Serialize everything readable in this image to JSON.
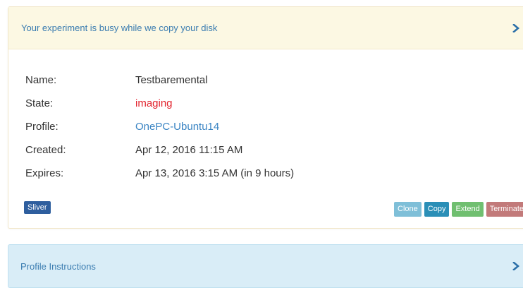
{
  "status_panel": {
    "heading": "Your experiment is busy while we copy your disk",
    "chevron_icon": "chevron-right-icon",
    "rows": [
      {
        "label": "Name:",
        "value": "Testbaremental"
      },
      {
        "label": "State:",
        "value": "imaging",
        "color": "#e2232d"
      },
      {
        "label": "Profile:",
        "value": "OnePC-Ubuntu14",
        "color": "#3a84c3"
      },
      {
        "label": "Created:",
        "value": "Apr 12, 2016 11:15 AM"
      },
      {
        "label": "Expires:",
        "value": "Apr 13, 2016 3:15 AM (in 9 hours)"
      }
    ],
    "badge": "Sliver",
    "buttons": {
      "clone": "Clone",
      "copy": "Copy",
      "extend": "Extend",
      "terminate": "Terminate"
    }
  },
  "instructions_panel": {
    "heading": "Profile Instructions",
    "chevron_icon": "chevron-right-icon"
  },
  "colors": {
    "warning_bg": "#fcf8e3",
    "info_bg": "#d9edf7",
    "link": "#3a84c3",
    "state_red": "#e2232d"
  }
}
